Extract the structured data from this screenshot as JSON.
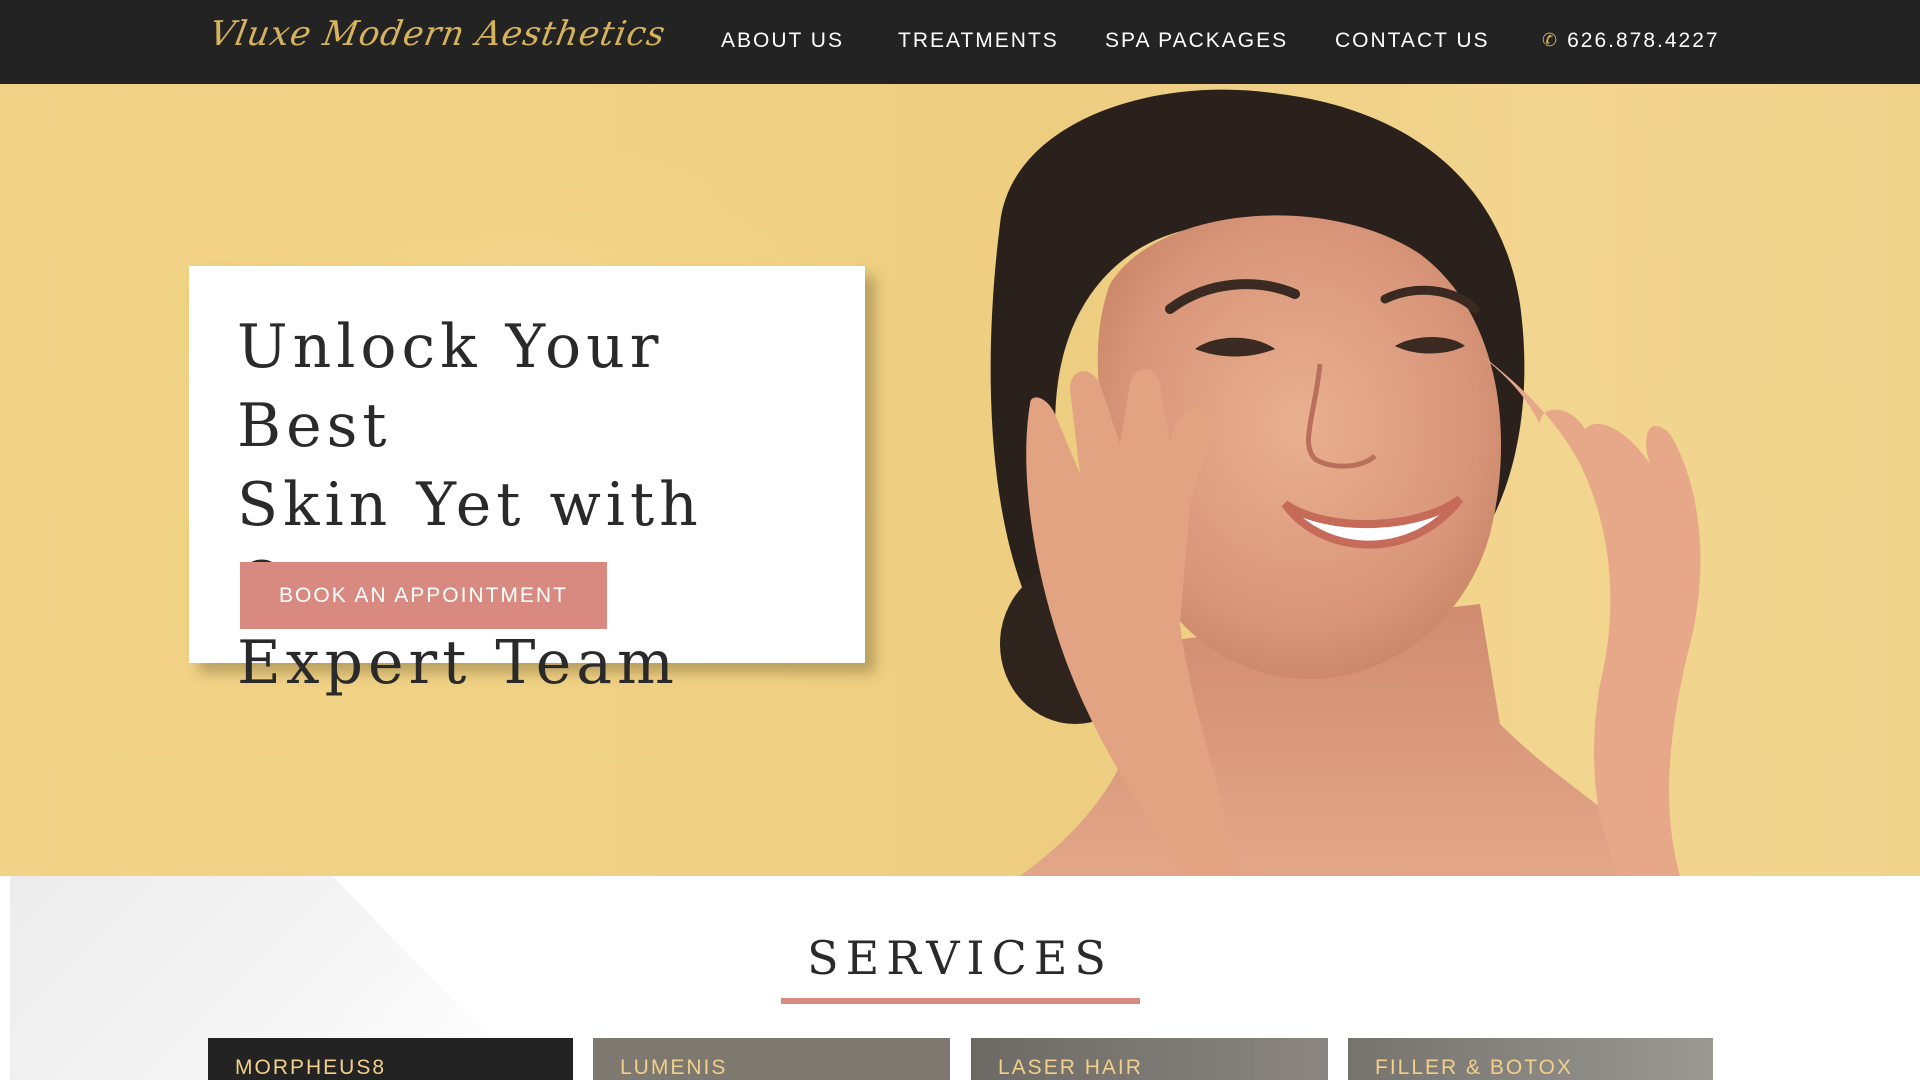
{
  "header": {
    "logo_text": "Vluxe Modern Aesthetics",
    "nav_items": [
      {
        "label": "ABOUT US"
      },
      {
        "label": "TREATMENTS"
      },
      {
        "label": "SPA PACKAGES"
      },
      {
        "label": "CONTACT US"
      }
    ],
    "phone_icon": "phone-icon",
    "phone": "626.878.4227"
  },
  "hero": {
    "heading_line_1": "Unlock Your Best",
    "heading_line_2": "Skin Yet with Our",
    "heading_line_3": "Expert Team",
    "cta_label": "BOOK AN APPOINTMENT"
  },
  "services": {
    "title": "SERVICES",
    "cards": [
      {
        "label": "MORPHEUS8"
      },
      {
        "label": "LUMENIS"
      },
      {
        "label": "LASER HAIR"
      },
      {
        "label": "FILLER & BOTOX"
      }
    ]
  },
  "colors": {
    "nav_bg": "#232323",
    "hero_bg": "#f0d183",
    "accent_rose": "#d98a80",
    "logo_gold": "#d6b25c"
  }
}
